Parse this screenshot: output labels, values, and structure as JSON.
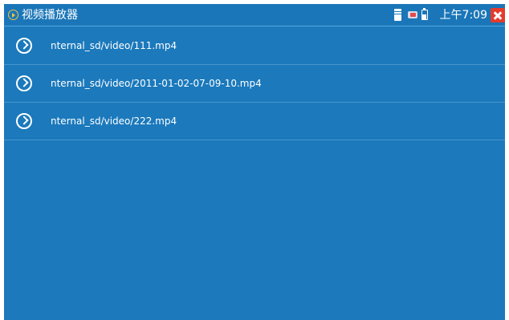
{
  "app": {
    "title": "视频播放器",
    "clock": "上午7:09"
  },
  "status_icons": [
    "sd-card-icon",
    "usb-icon",
    "battery-icon"
  ],
  "colors": {
    "background": "#1b79bc",
    "title_icon": "#f3c43a",
    "close_button": "#e53b2c"
  },
  "files": [
    {
      "path": "nternal_sd/video/111.mp4"
    },
    {
      "path": "nternal_sd/video/2011-01-02-07-09-10.mp4"
    },
    {
      "path": "nternal_sd/video/222.mp4"
    }
  ]
}
